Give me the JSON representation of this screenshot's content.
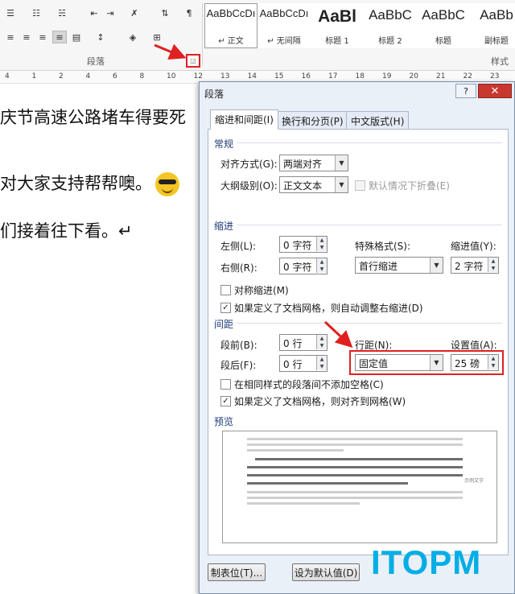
{
  "ribbon": {
    "paragraph_group_label": "段落",
    "styles_group_label": "样式",
    "styles": [
      {
        "preview": "AaBbCcDı",
        "name": "↵ 正文",
        "variant": "normal",
        "selected": true
      },
      {
        "preview": "AaBbCcDı",
        "name": "↵ 无间隔",
        "variant": "normal",
        "selected": false
      },
      {
        "preview": "AaBl",
        "name": "标题 1",
        "variant": "big",
        "selected": false
      },
      {
        "preview": "AaBbC",
        "name": "标题 2",
        "variant": "h2",
        "selected": false
      },
      {
        "preview": "AaBbC",
        "name": "标题",
        "variant": "h2",
        "selected": false
      },
      {
        "preview": "AaBb",
        "name": "副标题",
        "variant": "h2",
        "selected": false
      }
    ]
  },
  "ruler": {
    "ticks": [
      "4",
      "1",
      "2",
      "4",
      "6",
      "8",
      "10",
      "12",
      "13",
      "14",
      "15",
      "16",
      "17",
      "18",
      "19",
      "20",
      "21",
      "22",
      "23"
    ]
  },
  "document": {
    "lines": [
      "庆节高速公路堵车得要死",
      "对大家支持帮帮噢。",
      "们接着往下看。↵"
    ]
  },
  "dialog": {
    "title": "段落",
    "help_label": "?",
    "close_label": "✕",
    "tabs": [
      "缩进和间距(I)",
      "换行和分页(P)",
      "中文版式(H)"
    ],
    "general": {
      "section": "常规",
      "alignment_label": "对齐方式(G):",
      "alignment_value": "两端对齐",
      "outline_label": "大纲级别(O):",
      "outline_value": "正文文本",
      "collapse_label": "默认情况下折叠(E)"
    },
    "indent": {
      "section": "缩进",
      "left_label": "左侧(L):",
      "left_value": "0 字符",
      "right_label": "右侧(R):",
      "right_value": "0 字符",
      "special_label": "特殊格式(S):",
      "special_value": "首行缩进",
      "by_label": "缩进值(Y):",
      "by_value": "2 字符",
      "mirror_label": "对称缩进(M)",
      "auto_adjust_label": "如果定义了文档网格，则自动调整右缩进(D)"
    },
    "spacing": {
      "section": "间距",
      "before_label": "段前(B):",
      "before_value": "0 行",
      "after_label": "段后(F):",
      "after_value": "0 行",
      "line_label": "行距(N):",
      "line_value": "固定值",
      "at_label": "设置值(A):",
      "at_value": "25 磅",
      "no_space_label": "在相同样式的段落间不添加空格(C)",
      "snap_grid_label": "如果定义了文档网格，则对齐到网格(W)"
    },
    "preview": {
      "section": "预览",
      "sample_text": "示例文字"
    },
    "buttons": {
      "tabs": "制表位(T)...",
      "set_default": "设为默认值(D)"
    }
  },
  "watermark": "ITOPM",
  "colors": {
    "highlight": "#e02020",
    "watermark": "#00aee6",
    "dialog_bg": "#eaf0f8",
    "close_button": "#c7382f"
  }
}
